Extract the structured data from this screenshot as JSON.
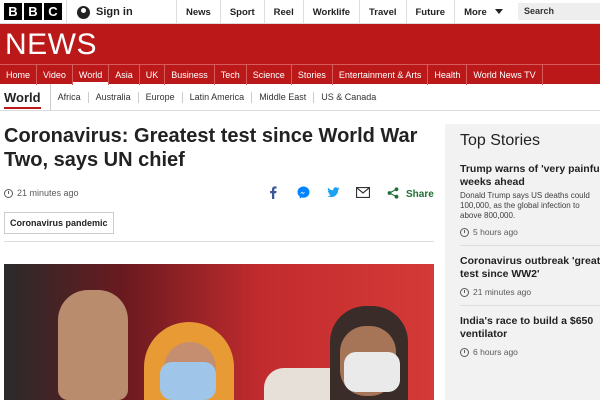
{
  "header": {
    "logo_letters": [
      "B",
      "B",
      "C"
    ],
    "sign_in_label": "Sign in",
    "top_nav": [
      "News",
      "Sport",
      "Reel",
      "Worklife",
      "Travel",
      "Future",
      "More"
    ],
    "search_placeholder": "Search"
  },
  "brand": {
    "title": "NEWS",
    "color": "#bb1919"
  },
  "main_nav": {
    "items": [
      "Home",
      "Video",
      "World",
      "Asia",
      "UK",
      "Business",
      "Tech",
      "Science",
      "Stories",
      "Entertainment & Arts",
      "Health",
      "World News TV"
    ],
    "active": "World"
  },
  "section_nav": {
    "title": "World",
    "items": [
      "Africa",
      "Australia",
      "Europe",
      "Latin America",
      "Middle East",
      "US & Canada"
    ]
  },
  "article": {
    "headline": "Coronavirus: Greatest test since World War Two, says UN chief",
    "timestamp": "21 minutes ago",
    "share_icons": [
      "facebook-icon",
      "messenger-icon",
      "twitter-icon",
      "email-icon"
    ],
    "share_label": "Share",
    "tag": "Coronavirus pandemic"
  },
  "sidebar": {
    "title": "Top Stories",
    "stories": [
      {
        "title": "Trump warns of 'very painful\nweeks ahead",
        "summary": "Donald Trump says US deaths could\n100,000, as the global infection to\nabove 800,000.",
        "time": "5 hours ago"
      },
      {
        "title": "Coronavirus outbreak 'great\ntest since WW2'",
        "summary": "",
        "time": "21 minutes ago"
      },
      {
        "title": "India's race to build a $650\nventilator",
        "summary": "",
        "time": "6 hours ago"
      }
    ]
  }
}
